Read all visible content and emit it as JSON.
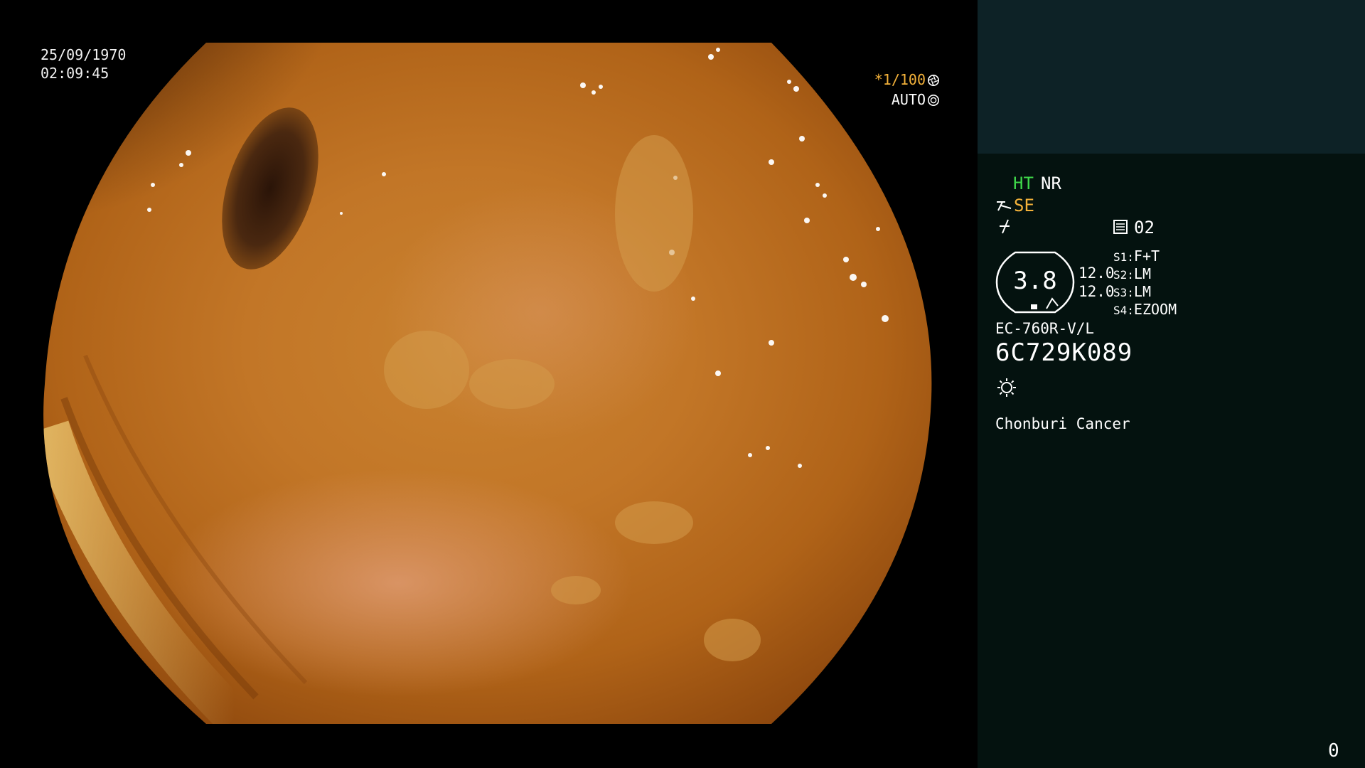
{
  "overlay": {
    "date": "25/09/1970",
    "time": "02:09:45",
    "shutter_speed": "*1/100",
    "iris_mode": "AUTO"
  },
  "panel": {
    "enhance_ht": "HT",
    "enhance_nr": "NR",
    "structure_mode": "SE",
    "memory_slot": "02",
    "zoom_level": "3.8",
    "param_upper": "12.0",
    "param_lower": "12.0",
    "switches": [
      {
        "key": "S1:",
        "value": "F+T"
      },
      {
        "key": "S2:",
        "value": "LM"
      },
      {
        "key": "S3:",
        "value": "LM"
      },
      {
        "key": "S4:",
        "value": "EZOOM"
      }
    ],
    "scope_model": "EC-760R-V/L",
    "scope_serial": "6C729K089",
    "institution": "Chonburi Cancer",
    "counter": "0"
  },
  "icons": {
    "shutter": "aperture-icon",
    "iris": "iris-icon",
    "structure": "structure-enhance-icon",
    "color": "color-mode-icon",
    "memory": "memory-card-icon",
    "light": "light-source-icon"
  },
  "colors": {
    "panel_top": "#0d2226",
    "panel_main": "#04120f",
    "accent_green": "#3fd84a",
    "accent_amber": "#f4b23a"
  }
}
